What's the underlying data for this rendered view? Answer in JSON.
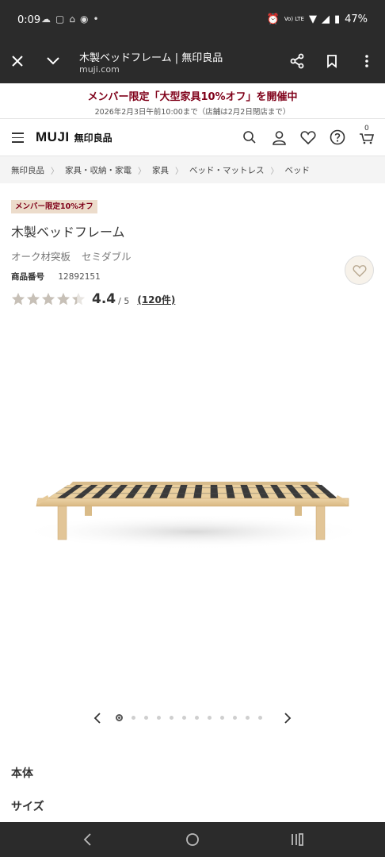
{
  "status_bar": {
    "time": "0:09",
    "battery": "47%",
    "network": "Vo) LTE"
  },
  "browser": {
    "title": "木製ベッドフレーム | 無印良品",
    "url": "muji.com"
  },
  "promo": {
    "headline": "メンバー限定「大型家具10%オフ」を開催中",
    "subtext": "2026年2月3日午前10:00まで（店舗は2月2日閉店まで）"
  },
  "header": {
    "logo_en": "MUJI",
    "logo_ja": "無印良品",
    "cart_count": "0"
  },
  "breadcrumb": [
    "無印良品",
    "家具・収納・家電",
    "家具",
    "ベッド・マットレス",
    "ベッド"
  ],
  "product": {
    "tag": "メンバー限定10%オフ",
    "name": "木製ベッドフレーム",
    "variant_material": "オーク材突板",
    "variant_size": "セミダブル",
    "code_label": "商品番号",
    "code": "12892151",
    "rating_value": "4.4",
    "rating_max": "/ 5",
    "rating_fraction": 0.88,
    "review_count": "(120件)"
  },
  "carousel": {
    "total": 12,
    "active_index": 0
  },
  "sections": {
    "body": "本体",
    "size": "サイズ"
  },
  "colors": {
    "promo_red": "#7f0019",
    "tag_bg": "#ecdccb",
    "system_bar": "#2b2b2b",
    "star": "#c7c0b7"
  }
}
